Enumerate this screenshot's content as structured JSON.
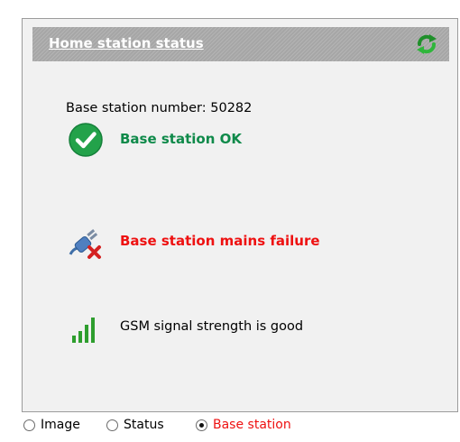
{
  "panel": {
    "title": "Home station status",
    "refresh_icon": "refresh-icon"
  },
  "base_station": {
    "number_label": "Base station number: 50282"
  },
  "statuses": [
    {
      "icon": "check-circle-icon",
      "text": "Base station OK",
      "color": "#0f8a4a"
    },
    {
      "icon": "unplugged-power-icon",
      "text": "Base station mains failure",
      "color": "#ee1111"
    },
    {
      "icon": "signal-bars-icon",
      "text": "GSM signal strength is good",
      "color": "#000000"
    }
  ],
  "view_options": {
    "options": [
      "Image",
      "Status",
      "Base station"
    ],
    "selected": "Base station"
  },
  "colors": {
    "ok": "#0f8a4a",
    "alert": "#ee1111",
    "signal": "#2e9e2e",
    "header": "#a6a6a6"
  }
}
